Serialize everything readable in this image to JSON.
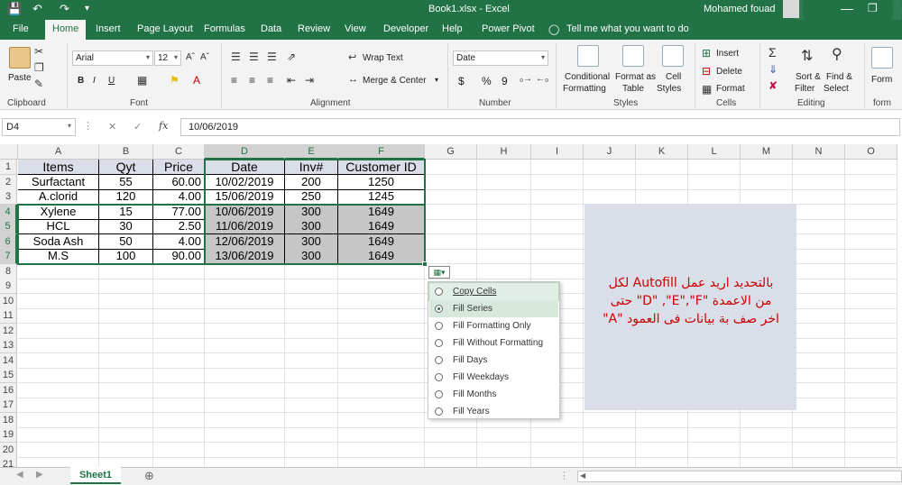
{
  "title_bar": {
    "document_title": "Book1.xlsx - Excel",
    "user_name": "Mohamed fouad",
    "qat_icons": [
      "save-icon",
      "undo-icon",
      "redo-icon",
      "customize-icon"
    ]
  },
  "ribbon_tabs": [
    "File",
    "Home",
    "Insert",
    "Page Layout",
    "Formulas",
    "Data",
    "Review",
    "View",
    "Developer",
    "Help",
    "Power Pivot"
  ],
  "active_tab": "Home",
  "tell_me": "Tell me what you want to do",
  "ribbon": {
    "clipboard": {
      "paste": "Paste",
      "label": "Clipboard"
    },
    "font": {
      "name": "Arial",
      "size": "12",
      "bold": "B",
      "italic": "I",
      "underline": "U",
      "label": "Font"
    },
    "alignment": {
      "wrap_text": "Wrap Text",
      "merge_center": "Merge & Center",
      "label": "Alignment"
    },
    "number": {
      "format": "Date",
      "currency": "$",
      "percent": "%",
      "comma": "9",
      "label": "Number"
    },
    "styles": {
      "conditional": "Conditional",
      "conditional2": "Formatting",
      "format_as": "Format as",
      "format_as2": "Table",
      "cell": "Cell",
      "cell2": "Styles",
      "label": "Styles"
    },
    "cells": {
      "insert": "Insert",
      "delete": "Delete",
      "format": "Format",
      "label": "Cells"
    },
    "editing": {
      "sort": "Sort &",
      "sort2": "Filter",
      "find": "Find &",
      "find2": "Select",
      "label": "Editing"
    },
    "form": {
      "label": "Form",
      "group": "form"
    }
  },
  "formula_bar": {
    "name_box": "D4",
    "cancel": "✕",
    "enter": "✓",
    "fx": "fx",
    "value": "10/06/2019"
  },
  "columns": [
    "A",
    "B",
    "C",
    "D",
    "E",
    "F",
    "G",
    "H",
    "I",
    "J",
    "K",
    "L",
    "M",
    "N",
    "O"
  ],
  "rows": [
    "1",
    "2",
    "3",
    "4",
    "5",
    "6",
    "7",
    "8",
    "9",
    "10",
    "11",
    "12",
    "13",
    "14",
    "15",
    "16",
    "17",
    "18",
    "19",
    "20",
    "21"
  ],
  "table": {
    "headers": [
      "Items",
      "Qyt",
      "Price",
      "Date",
      "Inv#",
      "Customer ID"
    ],
    "data": [
      [
        "Surfactant",
        "55",
        "60.00",
        "10/02/2019",
        "200",
        "1250"
      ],
      [
        "A.clorid",
        "120",
        "4.00",
        "15/06/2019",
        "250",
        "1245"
      ],
      [
        "Xylene",
        "15",
        "77.00",
        "10/06/2019",
        "300",
        "1649"
      ],
      [
        "HCL",
        "30",
        "2.50",
        "11/06/2019",
        "300",
        "1649"
      ],
      [
        "Soda Ash",
        "50",
        "4.00",
        "12/06/2019",
        "300",
        "1649"
      ],
      [
        "M.S",
        "100",
        "90.00",
        "13/06/2019",
        "300",
        "1649"
      ]
    ]
  },
  "autofill_menu": {
    "items": [
      "Copy Cells",
      "Fill Series",
      "Fill Formatting Only",
      "Fill Without Formatting",
      "Fill Days",
      "Fill Weekdays",
      "Fill Months",
      "Fill Years"
    ],
    "selected": "Fill Series",
    "hovered": "Copy Cells"
  },
  "note": {
    "line1": "بالتحديد اريد عمل Autofill لكل",
    "line2": "من الاعمدة \"D\" ,\"E\",\"F\" حتى",
    "line3": "اخر صف بة بيانات فى العمود \"A\""
  },
  "sheet_tabs": [
    "Sheet1"
  ],
  "colors": {
    "accent": "#217346",
    "header_fill": "#d9dee8",
    "range_fill": "#c6c6c6",
    "note_text": "#cc0000"
  }
}
